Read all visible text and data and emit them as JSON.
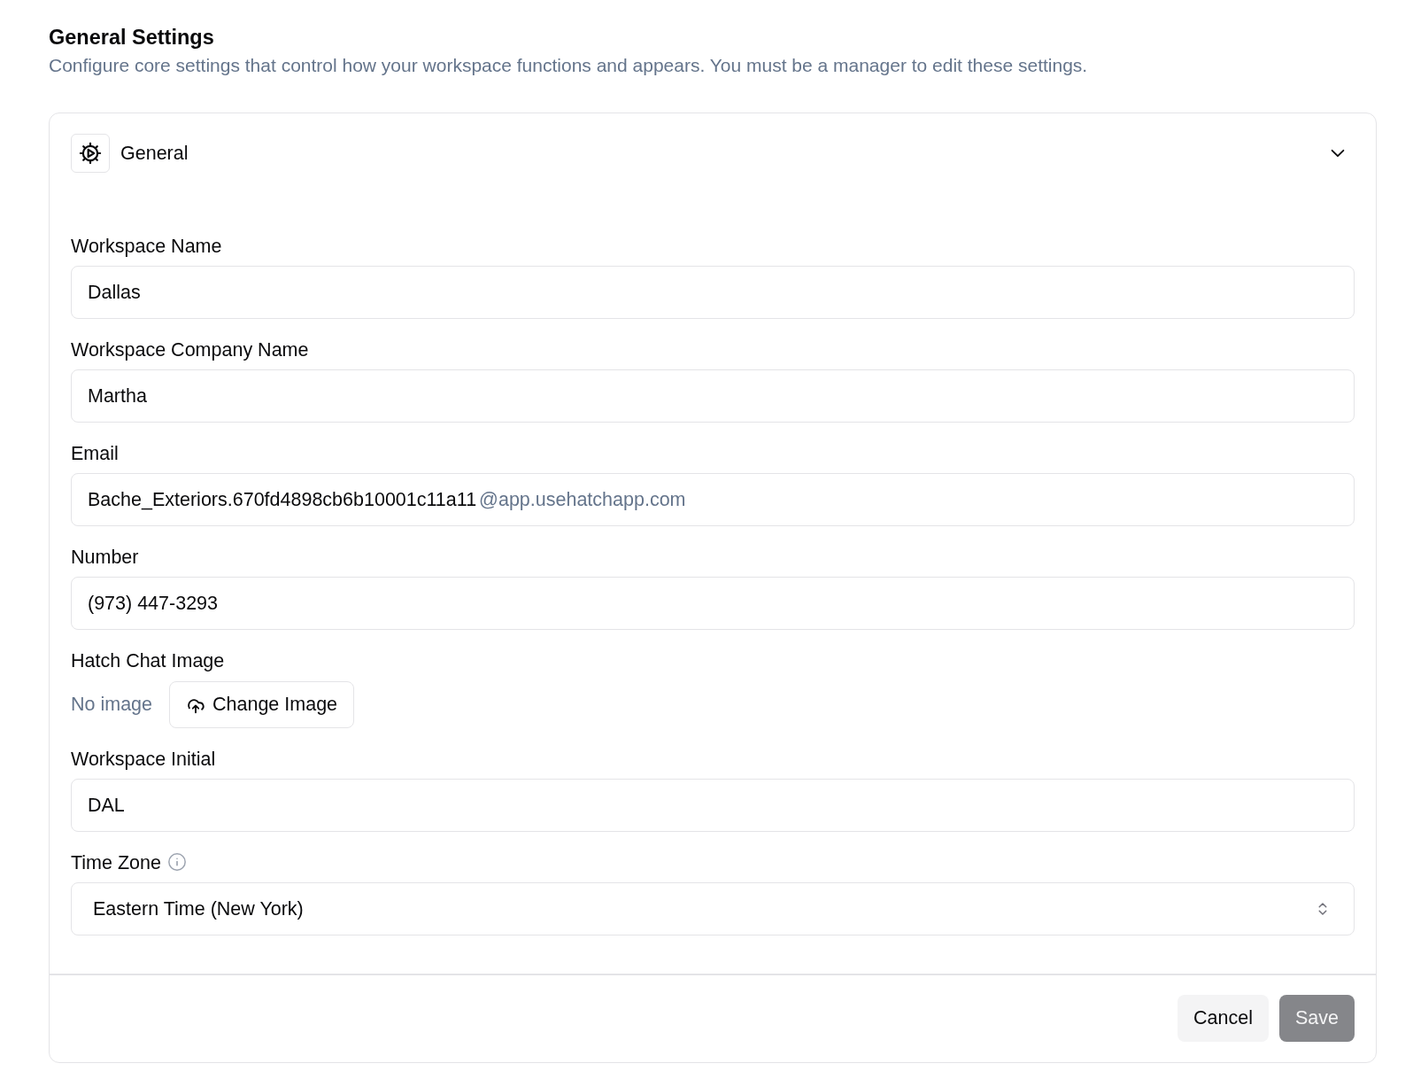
{
  "page": {
    "title": "General Settings",
    "subtitle": "Configure core settings that control how your workspace functions and appears. You must be a manager to edit these settings."
  },
  "section": {
    "title": "General",
    "expanded": true,
    "fields": [
      {
        "kind": "text",
        "label": "Workspace Name",
        "value": "Dallas"
      },
      {
        "kind": "text",
        "label": "Workspace Company Name",
        "value": "Martha"
      },
      {
        "kind": "email",
        "label": "Email",
        "value": "Bache_Exteriors.670fd4898cb6b10001c11a11",
        "suffix": "@app.usehatchapp.com"
      },
      {
        "kind": "text",
        "label": "Number",
        "value": "(973) 447-3293"
      },
      {
        "kind": "image",
        "label": "Hatch Chat Image",
        "status": "No image",
        "button": "Change Image"
      },
      {
        "kind": "text",
        "label": "Workspace Initial",
        "value": "DAL"
      },
      {
        "kind": "select",
        "label": "Time Zone",
        "info": true,
        "value": "Eastern Time (New York)"
      }
    ]
  },
  "footer": {
    "buttons": [
      {
        "kind": "secondary",
        "label": "Cancel",
        "disabled": false
      },
      {
        "kind": "primary",
        "label": "Save",
        "disabled": true
      }
    ]
  }
}
